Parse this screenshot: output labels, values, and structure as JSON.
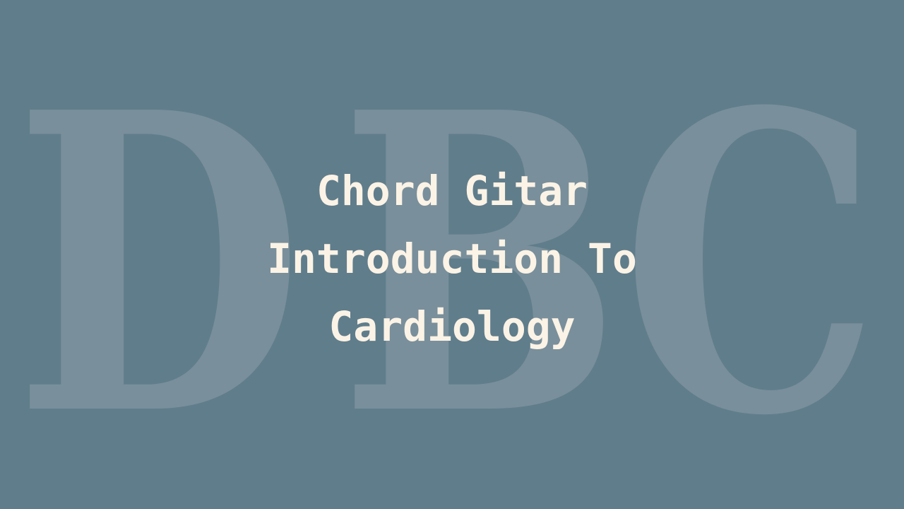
{
  "background": {
    "color": "#607d8b",
    "watermark": {
      "letters": [
        "D",
        "B",
        "C"
      ],
      "color": "#798f9b"
    }
  },
  "title": {
    "lines": [
      "Chord Gitar",
      "Introduction To",
      "Cardiology"
    ],
    "color": "#fbf3e6"
  }
}
